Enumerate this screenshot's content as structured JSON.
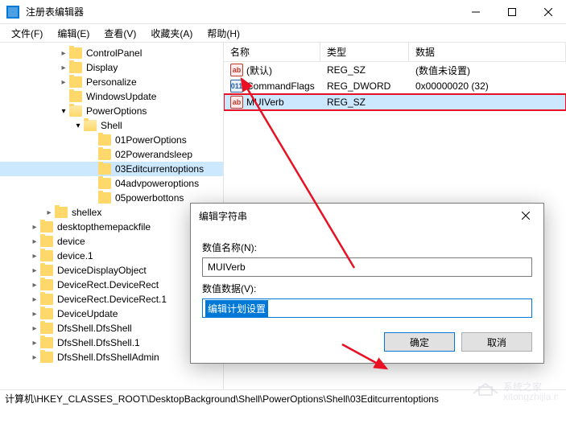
{
  "window": {
    "title": "注册表编辑器"
  },
  "menu": {
    "file": "文件(F)",
    "edit": "编辑(E)",
    "view": "查看(V)",
    "favorites": "收藏夹(A)",
    "help": "帮助(H)"
  },
  "tree": {
    "items": [
      {
        "indent": 3,
        "chev": "closed",
        "label": "ControlPanel"
      },
      {
        "indent": 3,
        "chev": "closed",
        "label": "Display"
      },
      {
        "indent": 3,
        "chev": "closed",
        "label": "Personalize"
      },
      {
        "indent": 3,
        "chev": "none",
        "label": "WindowsUpdate"
      },
      {
        "indent": 3,
        "chev": "open",
        "label": "PowerOptions",
        "open": true
      },
      {
        "indent": 4,
        "chev": "open",
        "label": "Shell",
        "open": true
      },
      {
        "indent": 5,
        "chev": "none",
        "label": "01PowerOptions"
      },
      {
        "indent": 5,
        "chev": "none",
        "label": "02Powerandsleep"
      },
      {
        "indent": 5,
        "chev": "none",
        "label": "03Editcurrentoptions",
        "selected": true
      },
      {
        "indent": 5,
        "chev": "none",
        "label": "04advpoweroptions"
      },
      {
        "indent": 5,
        "chev": "none",
        "label": "05powerbottons"
      },
      {
        "indent": 2,
        "chev": "closed",
        "label": "shellex"
      },
      {
        "indent": 1,
        "chev": "closed",
        "label": "desktopthemepackfile"
      },
      {
        "indent": 1,
        "chev": "closed",
        "label": "device"
      },
      {
        "indent": 1,
        "chev": "closed",
        "label": "device.1"
      },
      {
        "indent": 1,
        "chev": "closed",
        "label": "DeviceDisplayObject"
      },
      {
        "indent": 1,
        "chev": "closed",
        "label": "DeviceRect.DeviceRect"
      },
      {
        "indent": 1,
        "chev": "closed",
        "label": "DeviceRect.DeviceRect.1"
      },
      {
        "indent": 1,
        "chev": "closed",
        "label": "DeviceUpdate"
      },
      {
        "indent": 1,
        "chev": "closed",
        "label": "DfsShell.DfsShell"
      },
      {
        "indent": 1,
        "chev": "closed",
        "label": "DfsShell.DfsShell.1"
      },
      {
        "indent": 1,
        "chev": "closed",
        "label": "DfsShell.DfsShellAdmin"
      }
    ]
  },
  "list": {
    "columns": {
      "name": "名称",
      "type": "类型",
      "data": "数据"
    },
    "rows": [
      {
        "icon": "str",
        "name": "(默认)",
        "type": "REG_SZ",
        "data": "(数值未设置)"
      },
      {
        "icon": "bin",
        "name": "CommandFlags",
        "type": "REG_DWORD",
        "data": "0x00000020 (32)"
      },
      {
        "icon": "str",
        "name": "MUIVerb",
        "type": "REG_SZ",
        "data": "",
        "highlight": true
      }
    ]
  },
  "dialog": {
    "title": "编辑字符串",
    "name_label": "数值名称(N):",
    "name_value": "MUIVerb",
    "data_label": "数值数据(V):",
    "data_value": "编辑计划设置",
    "ok": "确定",
    "cancel": "取消"
  },
  "statusbar": {
    "path": "计算机\\HKEY_CLASSES_ROOT\\DesktopBackground\\Shell\\PowerOptions\\Shell\\03Editcurrentoptions"
  },
  "watermark": "系统之家"
}
